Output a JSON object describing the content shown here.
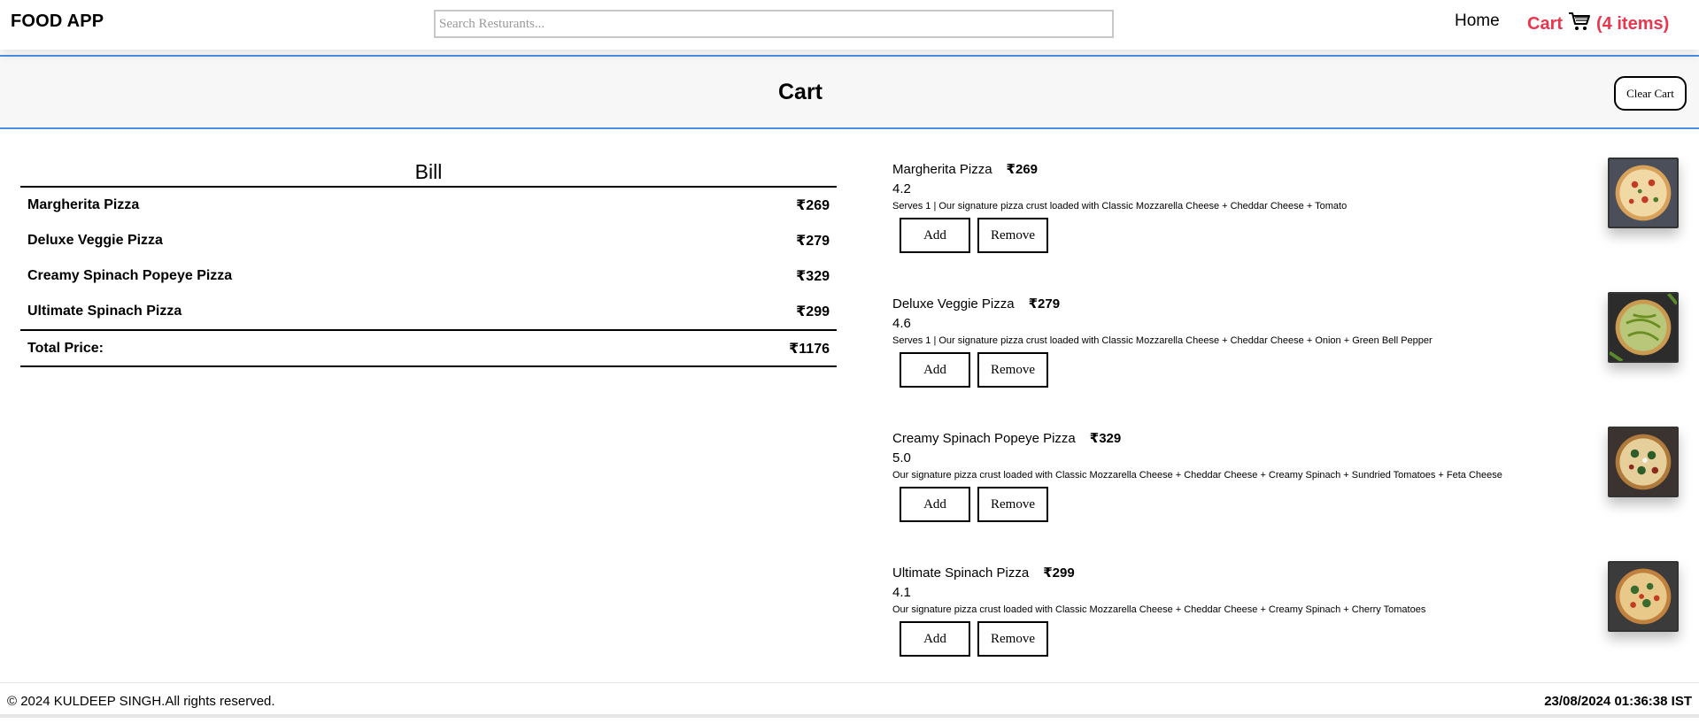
{
  "header": {
    "logo": "FOOD APP",
    "search_placeholder": "Search Resturants...",
    "home_label": "Home",
    "cart_label": "Cart",
    "cart_count": "(4 items)"
  },
  "cart": {
    "title": "Cart",
    "clear_label": "Clear Cart"
  },
  "bill": {
    "title": "Bill",
    "rows": [
      {
        "name": "Margherita Pizza",
        "price": "₹269"
      },
      {
        "name": "Deluxe Veggie Pizza",
        "price": "₹279"
      },
      {
        "name": "Creamy Spinach Popeye Pizza",
        "price": "₹329"
      },
      {
        "name": "Ultimate Spinach Pizza",
        "price": "₹299"
      }
    ],
    "total_label": "Total Price:",
    "total_value": "₹1176"
  },
  "items": [
    {
      "name": "Margherita Pizza",
      "price": "₹269",
      "rating": "4.2",
      "description": "Serves 1 | Our signature pizza crust loaded with Classic Mozzarella Cheese + Cheddar Cheese + Tomato",
      "add_label": "Add",
      "remove_label": "Remove",
      "image": "margherita-pizza-image",
      "topping_color": "#c23b22"
    },
    {
      "name": "Deluxe Veggie Pizza",
      "price": "₹279",
      "rating": "4.6",
      "description": "Serves 1 | Our signature pizza crust loaded with Classic Mozzarella Cheese + Cheddar Cheese + Onion + Green Bell Pepper",
      "add_label": "Add",
      "remove_label": "Remove",
      "image": "deluxe-veggie-pizza-image",
      "topping_color": "#6b8e23"
    },
    {
      "name": "Creamy Spinach Popeye Pizza",
      "price": "₹329",
      "rating": "5.0",
      "description": "Our signature pizza crust loaded with Classic Mozzarella Cheese + Cheddar Cheese + Creamy Spinach + Sundried Tomatoes + Feta Cheese",
      "add_label": "Add",
      "remove_label": "Remove",
      "image": "creamy-spinach-pizza-image",
      "topping_color": "#2f5d2a"
    },
    {
      "name": "Ultimate Spinach Pizza",
      "price": "₹299",
      "rating": "4.1",
      "description": "Our signature pizza crust loaded with Classic Mozzarella Cheese + Cheddar Cheese + Creamy Spinach + Cherry Tomatoes",
      "add_label": "Add",
      "remove_label": "Remove",
      "image": "ultimate-spinach-pizza-image",
      "topping_color": "#3a6b2e"
    }
  ],
  "footer": {
    "copyright": "© 2024 KULDEEP SINGH.All rights reserved.",
    "timestamp": "23/08/2024 01:36:38 IST"
  },
  "colors": {
    "accent": "#e8364f",
    "divider": "#4a90e2"
  }
}
